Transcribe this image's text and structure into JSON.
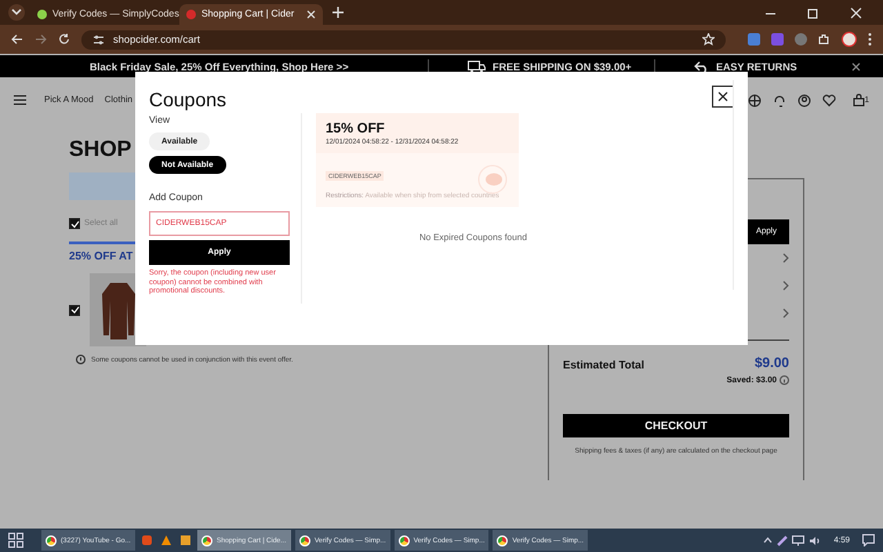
{
  "browser": {
    "tabs": [
      {
        "title": "Verify Codes — SimplyCodes",
        "selected": false
      },
      {
        "title": "Shopping Cart | Cider",
        "selected": true
      }
    ],
    "url": "shopcider.com/cart"
  },
  "promo_bar": {
    "sale": "Black Friday Sale, 25% Off Everything, Shop Here >>",
    "shipping": "FREE SHIPPING ON $39.00+",
    "returns": "EASY RETURNS"
  },
  "nav": {
    "items": [
      "Pick A Mood",
      "Clothin"
    ],
    "cart_count": "1"
  },
  "cart": {
    "title": "SHOP",
    "select_all": {
      "label": "Select all",
      "checked": true
    },
    "promo_heading": "25% OFF AT",
    "item": {
      "checked": true
    },
    "note": "Some coupons cannot be used in conjunction with this event offer."
  },
  "summary": {
    "apply": "Apply",
    "estimated_total_label": "Estimated Total",
    "total": "$9.00",
    "saved": "Saved: $3.00",
    "checkout": "CHECKOUT",
    "shipping_note": "Shipping fees & taxes (if any) are calculated on the checkout page"
  },
  "modal": {
    "title": "Coupons",
    "view_label": "View",
    "view_options": [
      {
        "label": "Available",
        "selected": false
      },
      {
        "label": "Not Available",
        "selected": true
      }
    ],
    "add_label": "Add Coupon",
    "code_value": "CIDERWEB15CAP",
    "apply": "Apply",
    "error": "Sorry, the coupon (including new user coupon) cannot be combined with promotional discounts.",
    "coupons": [
      {
        "discount": "15% OFF",
        "dates": "12/01/2024 04:58:22 - 12/31/2024 04:58:22",
        "code": "CIDERWEB15CAP",
        "restrictions_label": "Restrictions:",
        "restrictions": "Available when ship from selected countries"
      }
    ],
    "empty": "No Expired Coupons found"
  },
  "taskbar": {
    "items": [
      {
        "label": "(3227) YouTube - Go...",
        "selected": false
      },
      {
        "label": "Shopping Cart | Cide...",
        "selected": true
      },
      {
        "label": "Verify Codes — Simp...",
        "selected": false
      },
      {
        "label": "Verify Codes — Simp...",
        "selected": false
      },
      {
        "label": "Verify Codes — Simp...",
        "selected": false
      }
    ],
    "time": "4:59"
  }
}
